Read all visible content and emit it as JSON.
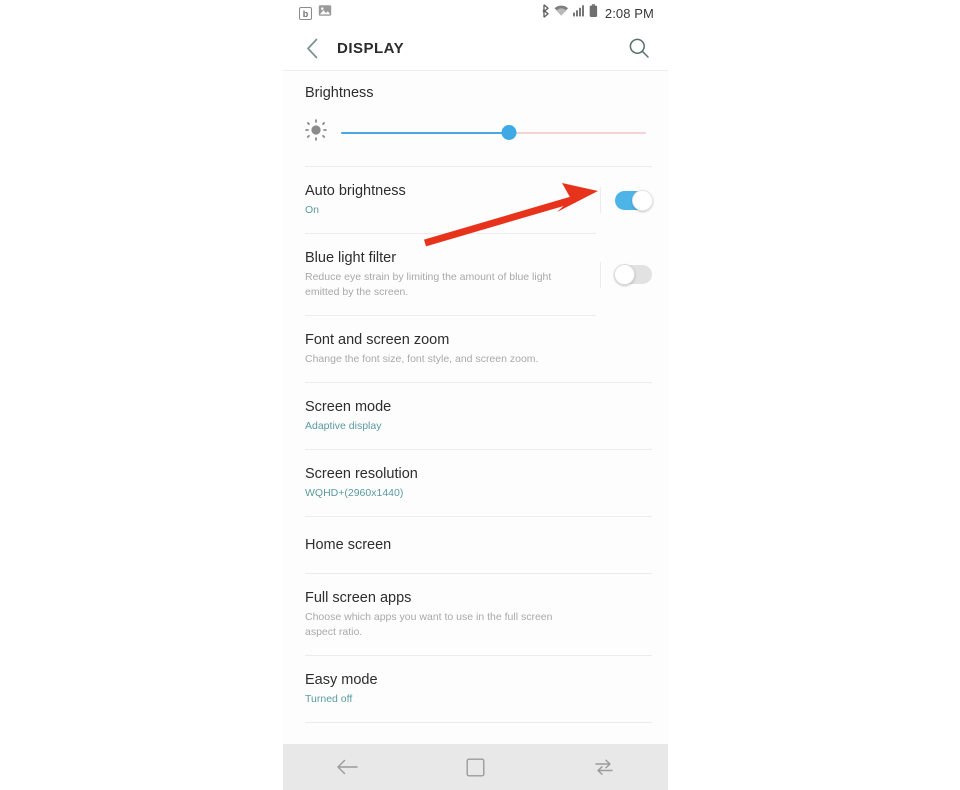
{
  "status_bar": {
    "left_icons": [
      "badge-b-icon",
      "image-icon"
    ],
    "badge_letter": "b",
    "right_icons": [
      "bluetooth-icon",
      "wifi-icon",
      "signal-icon",
      "battery-icon"
    ],
    "time": "2:08 PM"
  },
  "app_bar": {
    "back_icon": "back-chevron-icon",
    "title": "DISPLAY",
    "search_icon": "search-icon"
  },
  "brightness": {
    "label": "Brightness",
    "icon": "brightness-sun-icon",
    "value_percent": 55,
    "fill_color": "#4aa8e0",
    "thumb_color": "#3fa9e5",
    "remainder_color": "#f3d3d3"
  },
  "settings": [
    {
      "name": "auto-brightness",
      "title": "Auto brightness",
      "subtitle": "On",
      "subtitle_accent": true,
      "control": "toggle",
      "toggle_state": "on"
    },
    {
      "name": "blue-light-filter",
      "title": "Blue light filter",
      "subtitle": "Reduce eye strain by limiting the amount of blue light emitted by the screen.",
      "subtitle_accent": false,
      "control": "toggle",
      "toggle_state": "off"
    },
    {
      "name": "font-and-screen-zoom",
      "title": "Font and screen zoom",
      "subtitle": "Change the font size, font style, and screen zoom.",
      "subtitle_accent": false,
      "control": "none",
      "toggle_state": ""
    },
    {
      "name": "screen-mode",
      "title": "Screen mode",
      "subtitle": "Adaptive display",
      "subtitle_accent": true,
      "control": "none",
      "toggle_state": ""
    },
    {
      "name": "screen-resolution",
      "title": "Screen resolution",
      "subtitle": "WQHD+(2960x1440)",
      "subtitle_accent": true,
      "control": "none",
      "toggle_state": ""
    },
    {
      "name": "home-screen",
      "title": "Home screen",
      "subtitle": "",
      "subtitle_accent": false,
      "control": "none",
      "toggle_state": ""
    },
    {
      "name": "full-screen-apps",
      "title": "Full screen apps",
      "subtitle": "Choose which apps you want to use in the full screen aspect ratio.",
      "subtitle_accent": false,
      "control": "none",
      "toggle_state": ""
    },
    {
      "name": "easy-mode",
      "title": "Easy mode",
      "subtitle": "Turned off",
      "subtitle_accent": true,
      "control": "none",
      "toggle_state": ""
    }
  ],
  "nav_bar": {
    "back_icon": "nav-back-icon",
    "home_icon": "nav-home-icon",
    "recents_icon": "nav-recents-icon"
  },
  "annotation": {
    "type": "arrow",
    "color": "#e8331c",
    "points_to": "auto-brightness-toggle"
  },
  "colors": {
    "accent_teal": "#5a9ba0",
    "toggle_on": "#4db4e8",
    "toggle_off": "#e2e2e2",
    "annotation_red": "#e8331c"
  }
}
